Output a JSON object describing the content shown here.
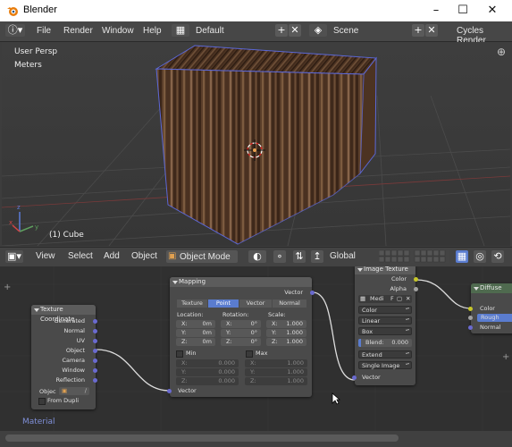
{
  "window": {
    "title": "Blender"
  },
  "menubar": {
    "menus": [
      "File",
      "Render",
      "Window",
      "Help"
    ],
    "layout": "Default",
    "scene": "Scene",
    "engine": "Cycles Render"
  },
  "viewport": {
    "view_label": "User Persp",
    "units_label": "Meters",
    "object_label": "(1) Cube",
    "colors": {
      "bg": "#393939",
      "grid": "#4a4a4a",
      "wood_dark": "#3e2a1c",
      "wood_light": "#7a5a40",
      "selection": "#5b68d8"
    }
  },
  "view_header": {
    "menus": [
      "View",
      "Select",
      "Add",
      "Object"
    ],
    "mode": "Object Mode",
    "orientation": "Global"
  },
  "node_editor": {
    "label": "Material",
    "tex_coord": {
      "title": "Texture Coordinate",
      "outputs": [
        "Generated",
        "Normal",
        "UV",
        "Object",
        "Camera",
        "Window",
        "Reflection"
      ],
      "object_label": "Objec",
      "from_dupli": "From Dupli"
    },
    "mapping": {
      "title": "Mapping",
      "output": "Vector",
      "tabs": [
        "Texture",
        "Point",
        "Vector",
        "Normal"
      ],
      "active_tab": "Point",
      "location_label": "Location:",
      "rotation_label": "Rotation:",
      "scale_label": "Scale:",
      "rows": [
        {
          "axis": "X:",
          "loc": "0m",
          "rot": "0°",
          "scale": "1.000"
        },
        {
          "axis": "Y:",
          "loc": "0m",
          "rot": "0°",
          "scale": "1.000"
        },
        {
          "axis": "Z:",
          "loc": "0m",
          "rot": "0°",
          "scale": "1.000"
        }
      ],
      "min_label": "Min",
      "max_label": "Max",
      "min_rows": [
        {
          "axis": "X:",
          "val": "0.000"
        },
        {
          "axis": "Y:",
          "val": "0.000"
        },
        {
          "axis": "Z:",
          "val": "0.000"
        }
      ],
      "max_rows": [
        {
          "axis": "X:",
          "val": "1.000"
        },
        {
          "axis": "Y:",
          "val": "1.000"
        },
        {
          "axis": "Z:",
          "val": "1.000"
        }
      ],
      "input": "Vector"
    },
    "image_texture": {
      "title": "Image Texture",
      "outputs": [
        "Color",
        "Alpha"
      ],
      "image_name": "Medi",
      "image_flag": "F",
      "color_space": "Color",
      "interpolation": "Linear",
      "projection": "Box",
      "blend_label": "Blend:",
      "blend_value": "0.000",
      "extension": "Extend",
      "source": "Single Image",
      "input": "Vector"
    },
    "diffuse": {
      "title": "Diffuse",
      "inputs": [
        "Color",
        "Rough",
        "Normal"
      ]
    }
  }
}
